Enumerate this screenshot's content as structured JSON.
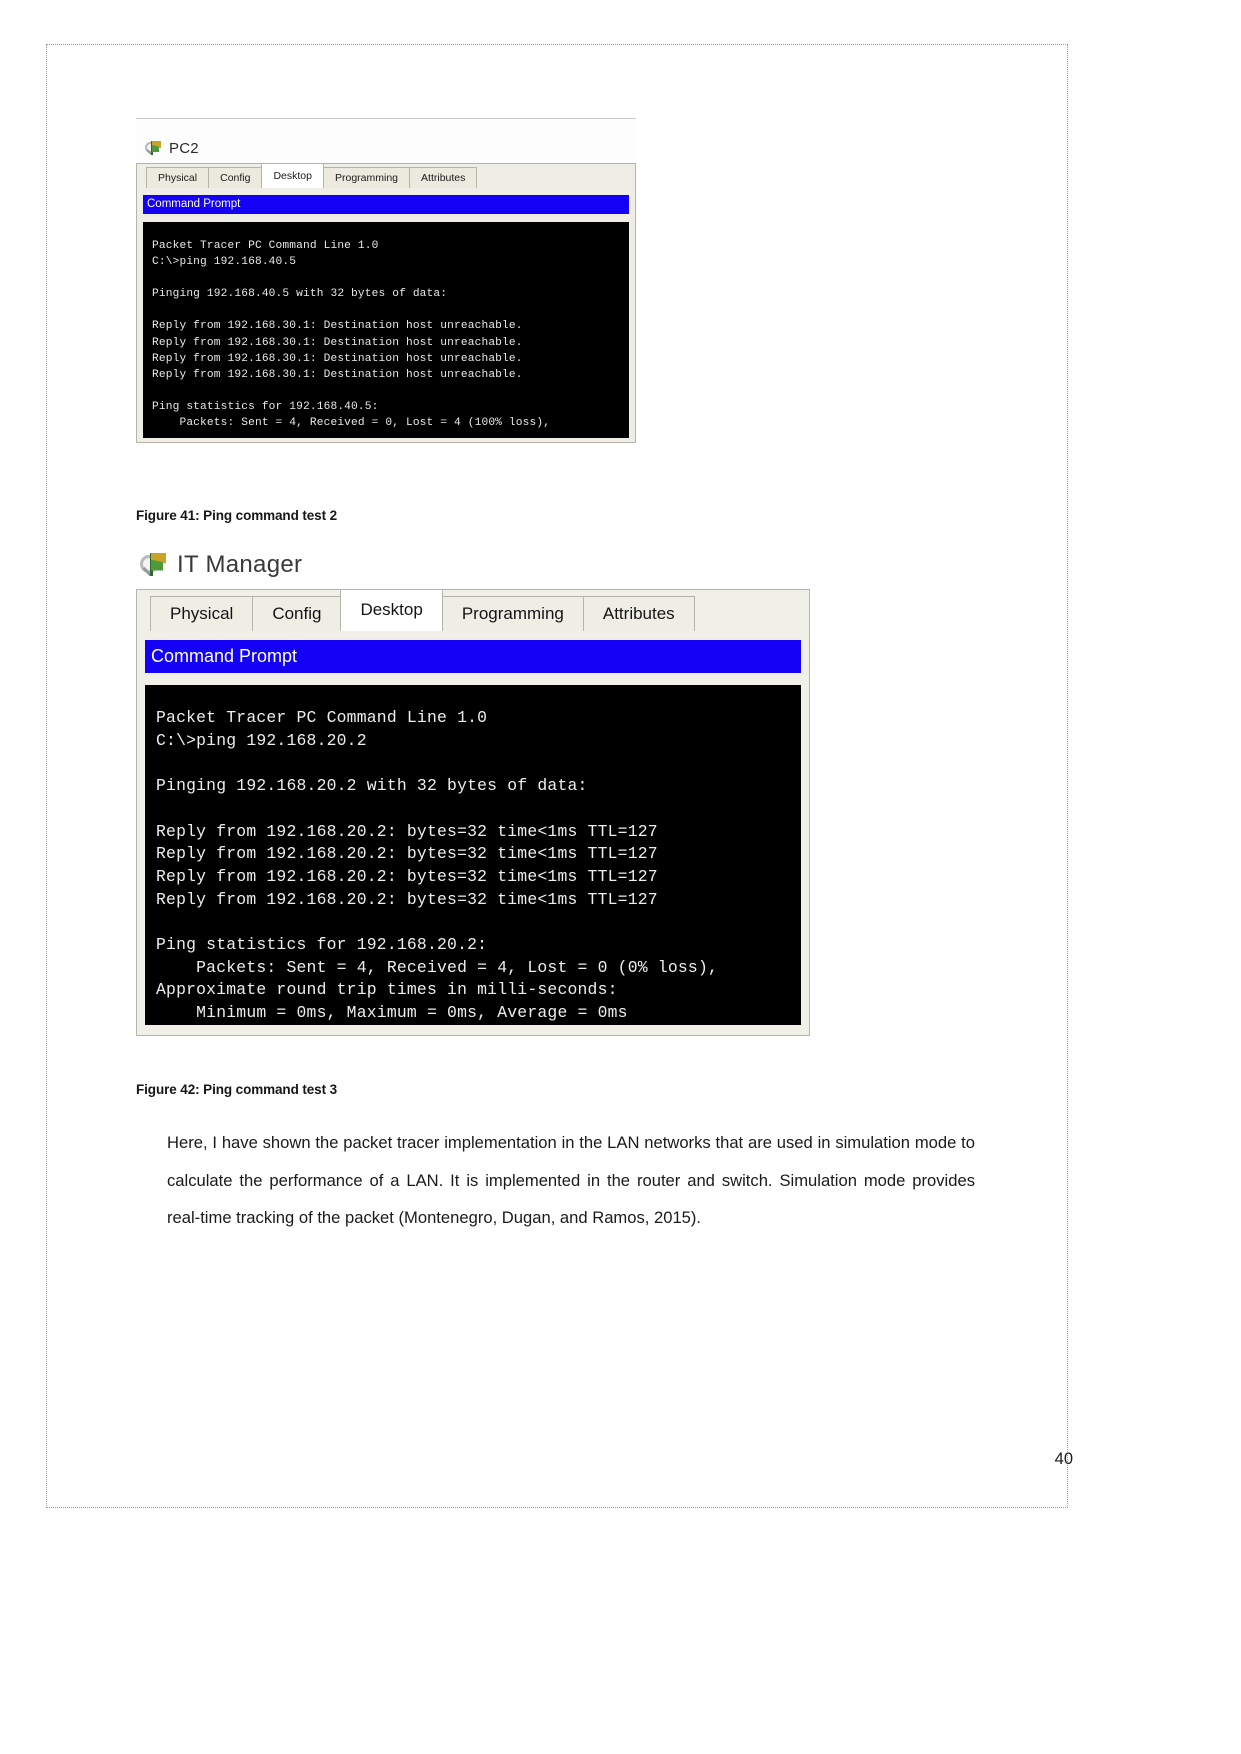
{
  "document": {
    "page_number": "40"
  },
  "figure_41": {
    "device_name": "PC2",
    "tabs": [
      {
        "label": "Physical",
        "active": false
      },
      {
        "label": "Config",
        "active": false
      },
      {
        "label": "Desktop",
        "active": true
      },
      {
        "label": "Programming",
        "active": false
      },
      {
        "label": "Attributes",
        "active": false
      }
    ],
    "window_title": "Command Prompt",
    "terminal_text": "Packet Tracer PC Command Line 1.0\nC:\\>ping 192.168.40.5\n\nPinging 192.168.40.5 with 32 bytes of data:\n\nReply from 192.168.30.1: Destination host unreachable.\nReply from 192.168.30.1: Destination host unreachable.\nReply from 192.168.30.1: Destination host unreachable.\nReply from 192.168.30.1: Destination host unreachable.\n\nPing statistics for 192.168.40.5:\n    Packets: Sent = 4, Received = 0, Lost = 4 (100% loss),",
    "caption": "Figure 41: Ping command test 2"
  },
  "figure_42": {
    "device_name": "IT Manager",
    "tabs": [
      {
        "label": "Physical",
        "active": false
      },
      {
        "label": "Config",
        "active": false
      },
      {
        "label": "Desktop",
        "active": true
      },
      {
        "label": "Programming",
        "active": false
      },
      {
        "label": "Attributes",
        "active": false
      }
    ],
    "window_title": "Command Prompt",
    "terminal_text": "Packet Tracer PC Command Line 1.0\nC:\\>ping 192.168.20.2\n\nPinging 192.168.20.2 with 32 bytes of data:\n\nReply from 192.168.20.2: bytes=32 time<1ms TTL=127\nReply from 192.168.20.2: bytes=32 time<1ms TTL=127\nReply from 192.168.20.2: bytes=32 time<1ms TTL=127\nReply from 192.168.20.2: bytes=32 time<1ms TTL=127\n\nPing statistics for 192.168.20.2:\n    Packets: Sent = 4, Received = 4, Lost = 0 (0% loss),\nApproximate round trip times in milli-seconds:\n    Minimum = 0ms, Maximum = 0ms, Average = 0ms",
    "caption": "Figure 42: Ping command test 3"
  },
  "body": {
    "paragraph": "Here, I have shown the packet tracer implementation in the LAN networks that are used in simulation mode to calculate the performance of a LAN. It is implemented in the router and switch. Simulation mode provides real-time tracking of the packet (Montenegro, Dugan, and Ramos, 2015)."
  },
  "colors": {
    "title_bar_blue": "#1300f5",
    "terminal_bg": "#000000",
    "panel_bg": "#efeee6"
  }
}
